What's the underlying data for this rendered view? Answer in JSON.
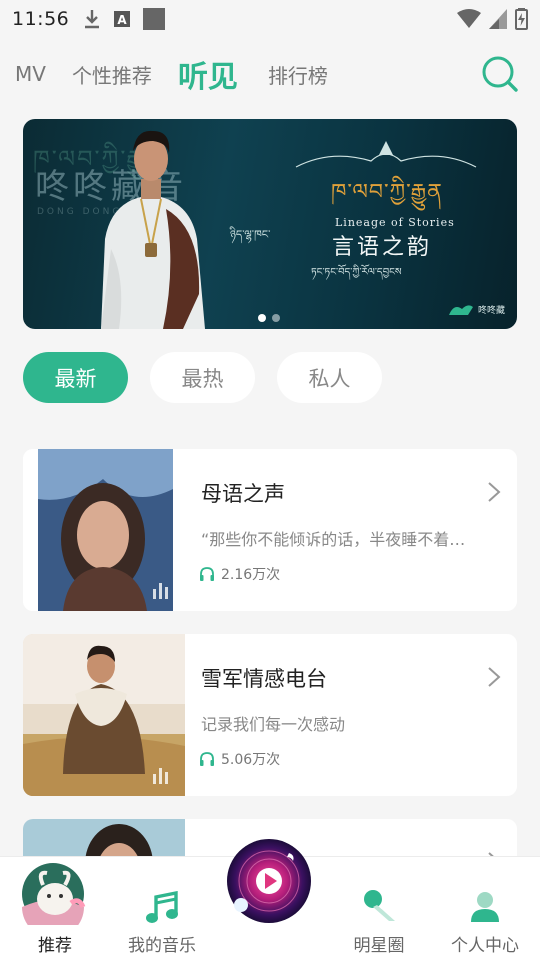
{
  "status_bar": {
    "time": "11:56",
    "left_icons": [
      "download-icon",
      "a-box-icon",
      "square-icon"
    ],
    "right_icons": [
      "wifi-icon",
      "signal-icon",
      "battery-charging-icon"
    ]
  },
  "top_nav": {
    "tabs": [
      {
        "label": "MV",
        "active": false
      },
      {
        "label": "个性推荐",
        "active": false
      },
      {
        "label": "听见",
        "active": true
      },
      {
        "label": "排行榜",
        "active": false
      }
    ],
    "search_icon": "search-icon"
  },
  "banner": {
    "brand_text": "咚咚藏音",
    "brand_sub": "DONG DONG MUSIC",
    "tibetan_small": "ཉིད་ལྷ་ཁང་",
    "tibetan_title": "ཁ་ལབ་ཀྱི་རྒྱུན",
    "english_title": "Lineage of Stories",
    "chinese_title": "言语之韵",
    "tibetan_sub": "ཏང་ཏང་བོད་ཀྱི་རོལ་དབྱངས",
    "logo_text": "咚咚藏",
    "page_count": 2,
    "active_page": 1
  },
  "filters": [
    {
      "label": "最新",
      "active": true
    },
    {
      "label": "最热",
      "active": false
    },
    {
      "label": "私人",
      "active": false
    }
  ],
  "cards": [
    {
      "title": "母语之声",
      "description": "“那些你不能倾诉的话，半夜睡不着…",
      "plays": "2.16万次"
    },
    {
      "title": "雪军情感电台",
      "description": "记录我们每一次感动",
      "plays": "5.06万次"
    },
    {
      "title": "",
      "description": "",
      "plays": ""
    }
  ],
  "bottom_nav": {
    "items": [
      {
        "label": "推荐",
        "icon": "goat-avatar-icon",
        "active": true
      },
      {
        "label": "我的音乐",
        "icon": "music-note-icon",
        "active": false
      },
      {
        "label": "明星圈",
        "icon": "microphone-icon",
        "active": false
      },
      {
        "label": "个人中心",
        "icon": "user-icon",
        "active": false
      }
    ],
    "player_icon": "play-icon"
  },
  "colors": {
    "accent": "#2fb68e",
    "background": "#f5f5f5",
    "banner_bg": "#0f4150",
    "banner_gold": "#e0a13a"
  }
}
